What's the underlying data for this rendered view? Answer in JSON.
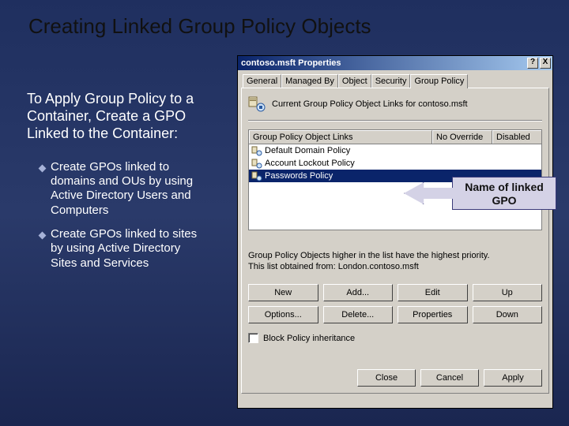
{
  "slide": {
    "title": "Creating Linked Group Policy Objects",
    "body": "To Apply Group Policy to a Container, Create a GPO Linked to the Container:",
    "bullet1": "Create GPOs linked to domains and OUs by using Active Directory Users and Computers",
    "bullet2": "Create GPOs linked to sites by using Active Directory Sites and Services"
  },
  "dialog": {
    "title": "contoso.msft Properties",
    "help_icon": "?",
    "close_icon": "X",
    "tabs": {
      "general": "General",
      "managed_by": "Managed By",
      "object": "Object",
      "security": "Security",
      "group_policy": "Group Policy"
    },
    "header_text": "Current Group Policy Object Links for contoso.msft",
    "columns": {
      "links": "Group Policy Object Links",
      "no_override": "No Override",
      "disabled": "Disabled"
    },
    "rows": [
      {
        "name": "Default Domain Policy",
        "selected": false
      },
      {
        "name": "Account Lockout Policy",
        "selected": false
      },
      {
        "name": "Passwords Policy",
        "selected": true
      }
    ],
    "priority_note_1": "Group Policy Objects higher in the list have the highest priority.",
    "priority_note_2": "This list obtained from: London.contoso.msft",
    "buttons": {
      "new": "New",
      "add": "Add...",
      "edit": "Edit",
      "up": "Up",
      "options": "Options...",
      "delete": "Delete...",
      "properties": "Properties",
      "down": "Down"
    },
    "block_inherit": "Block Policy inheritance",
    "footer": {
      "close": "Close",
      "cancel": "Cancel",
      "apply": "Apply"
    }
  },
  "callout": {
    "line1": "Name of linked",
    "line2": "GPO"
  }
}
